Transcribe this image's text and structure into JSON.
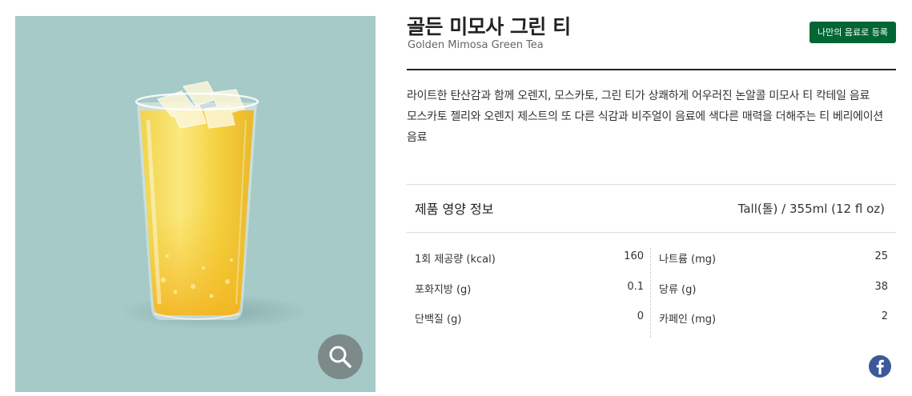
{
  "product": {
    "name_ko": "골든 미모사 그린 티",
    "name_en": "Golden Mimosa Green Tea",
    "register_button_label": "나만의 음료로 등록",
    "description_lines": [
      "라이트한 탄산감과 함께 오렌지, 모스카토, 그린 티가 상쾌하게 어우러진 논알콜 미모사 티 칵테일 음료",
      "모스카토 젤리와 오렌지 제스트의 또 다른 식감과 비주얼이 음료에 색다른 매력을 더해주는 티 베리에이션 음료"
    ]
  },
  "image": {
    "background_color": "#a6cac7",
    "zoom_icon": "magnifier-icon"
  },
  "nutrition": {
    "title": "제품 영양 정보",
    "serving": "Tall(톨) / 355ml (12 fl oz)",
    "left": [
      {
        "label": "1회 제공량 (kcal)",
        "value": "160"
      },
      {
        "label": "포화지방 (g)",
        "value": "0.1"
      },
      {
        "label": "단백질 (g)",
        "value": "0"
      }
    ],
    "right": [
      {
        "label": "나트륨 (mg)",
        "value": "25"
      },
      {
        "label": "당류 (g)",
        "value": "38"
      },
      {
        "label": "카페인 (mg)",
        "value": "2"
      }
    ]
  },
  "social": {
    "facebook_icon": "facebook-icon",
    "facebook_color": "#3b5998"
  },
  "colors": {
    "brand_green": "#006633"
  }
}
